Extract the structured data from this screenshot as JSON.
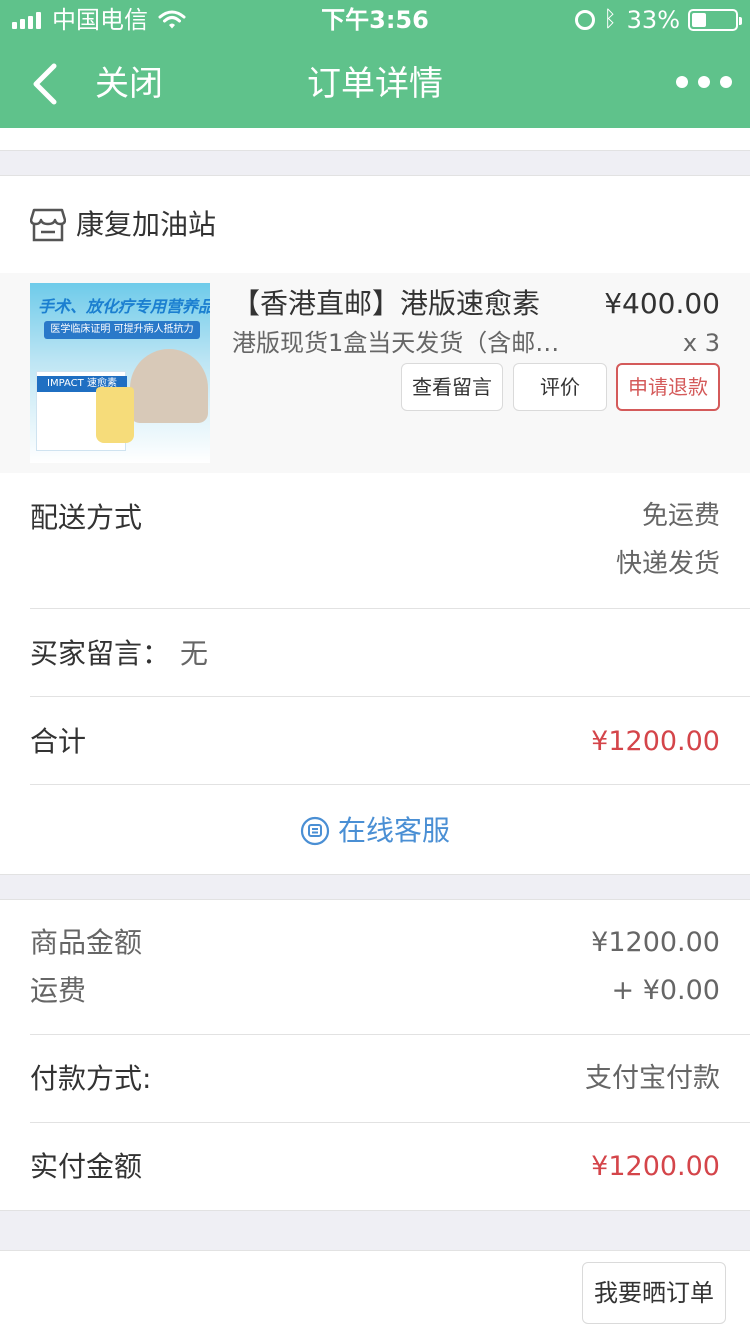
{
  "status_bar": {
    "carrier": "中国电信",
    "time": "下午3:56",
    "battery": "33%",
    "battery_level": 0.33
  },
  "nav": {
    "back_icon": "chevron-left-icon",
    "close_label": "关闭",
    "title": "订单详情",
    "more_icon": "more-dots-icon"
  },
  "shop": {
    "icon": "store-icon",
    "name": "康复加油站"
  },
  "product": {
    "name": "【香港直邮】港版速愈素",
    "price": "¥400.00",
    "description": "港版现货1盒当天发货（含邮…",
    "quantity": "x 3",
    "image_banner": "手术、放化疗专用营养品",
    "image_subtitle": "医学临床证明 可提升病人抵抗力",
    "image_box_brand": "IMPACT 速愈素",
    "buttons": {
      "view_message": "查看留言",
      "review": "评价",
      "refund": "申请退款"
    }
  },
  "delivery": {
    "label": "配送方式",
    "shipping_fee": "免运费",
    "method": "快递发货"
  },
  "buyer_message": {
    "label": "买家留言：",
    "value": "无"
  },
  "total": {
    "label": "合计",
    "value": "¥1200.00"
  },
  "customer_service": {
    "icon": "chat-bubble-icon",
    "label": "在线客服"
  },
  "summary": {
    "goods_label": "商品金额",
    "goods_value": "¥1200.00",
    "freight_label": "运费",
    "freight_value": "+ ¥0.00"
  },
  "payment": {
    "label": "付款方式:",
    "value": "支付宝付款"
  },
  "paid": {
    "label": "实付金额",
    "value": "¥1200.00"
  },
  "footer": {
    "show_order_button": "我要晒订单"
  },
  "colors": {
    "nav_green": "#5fc28b",
    "price_red": "#d4454a",
    "link_blue": "#4a8fd4",
    "refund_red": "#d45a5a"
  }
}
